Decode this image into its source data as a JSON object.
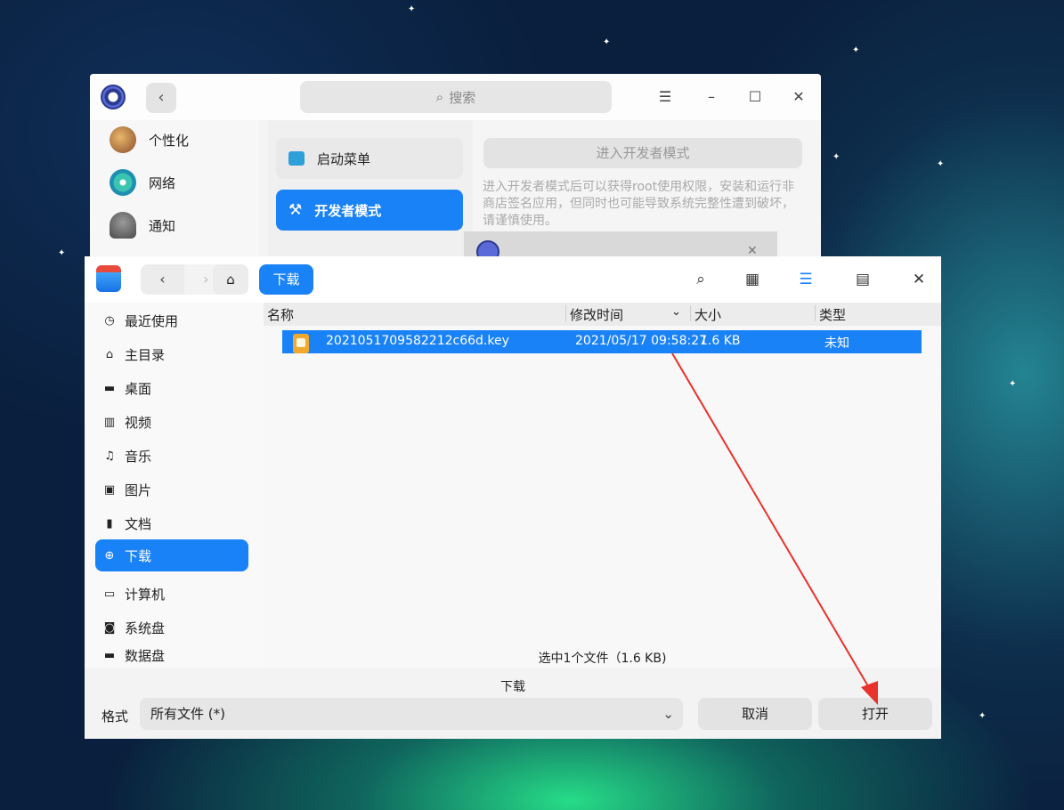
{
  "settings": {
    "search_placeholder": "搜索",
    "nav": [
      "个性化",
      "网络",
      "通知"
    ],
    "mid": [
      "启动菜单",
      "开发者模式"
    ],
    "developer_button": "进入开发者模式",
    "developer_desc": "进入开发者模式后可以获得root使用权限，安装和运行非商店签名应用，但同时也可能导致系统完整性遭到破坏，请谨慎使用。"
  },
  "dialog": {
    "breadcrumb": "下载",
    "sidebar": [
      "最近使用",
      "主目录",
      "桌面",
      "视频",
      "音乐",
      "图片",
      "文档",
      "下载",
      "计算机",
      "系统盘",
      "数据盘"
    ],
    "columns": [
      "名称",
      "修改时间",
      "大小",
      "类型"
    ],
    "file": {
      "name": "2021051709582212c66d.key",
      "modified": "2021/05/17 09:58:27",
      "size": "1.6 KB",
      "type": "未知"
    },
    "status": "选中1个文件（1.6 KB)",
    "folder_name": "下载",
    "format_label": "格式",
    "format_value": "所有文件 (*)",
    "cancel": "取消",
    "open": "打开"
  },
  "colors": {
    "accent": "#1a82f7",
    "annotation_arrow": "#e8322b"
  }
}
